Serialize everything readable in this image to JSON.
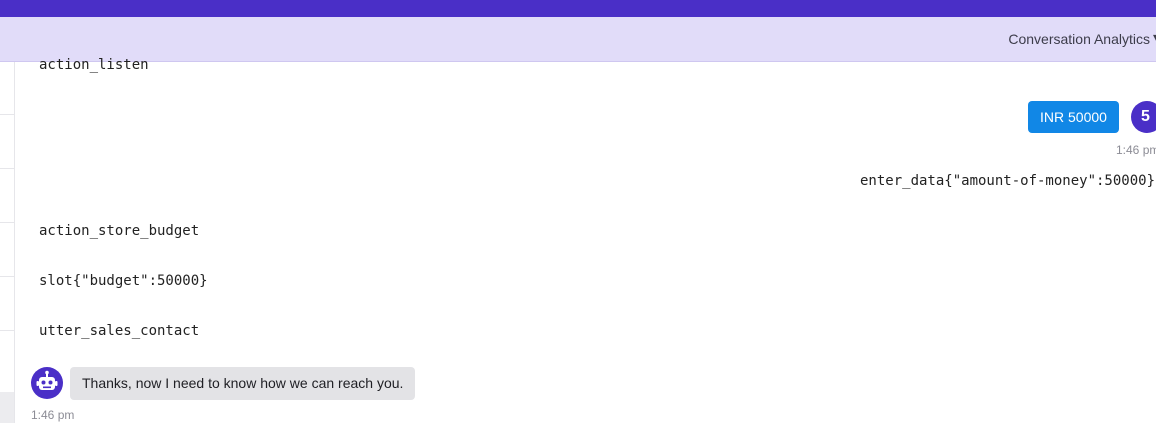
{
  "header": {
    "title": "Conversation Analytics",
    "caret_icon": "chevron-down-icon",
    "colors": {
      "topbar": "#4a2fc7",
      "subbar": "#e1dcf9"
    }
  },
  "conversation": {
    "events": [
      {
        "type": "action",
        "text": "action_listen"
      },
      {
        "type": "user_message",
        "text": "INR 50000",
        "avatar_text": "5",
        "time": "1:46 pm"
      },
      {
        "type": "intent",
        "text": "enter_data{\"amount-of-money\":50000}"
      },
      {
        "type": "action",
        "text": "action_store_budget"
      },
      {
        "type": "slot",
        "text": "slot{\"budget\":50000}"
      },
      {
        "type": "action",
        "text": "utter_sales_contact"
      },
      {
        "type": "bot_message",
        "text": "Thanks, now I need to know how we can reach you.",
        "avatar_icon": "robot-icon",
        "time": "1:46 pm"
      }
    ],
    "colors": {
      "user_bubble": "#1187e6",
      "bot_bubble": "#e3e3e6",
      "avatar": "#4a2fc7"
    }
  }
}
